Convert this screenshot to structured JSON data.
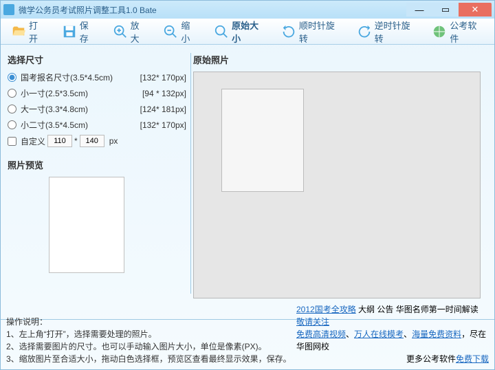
{
  "window": {
    "title": "微学公务员考试照片调整工具1.0 Bate"
  },
  "toolbar": {
    "open": "打开",
    "save": "保存",
    "zoomIn": "放大",
    "zoomOut": "缩小",
    "originalSize": "原始大小",
    "rotateCW": "顺时针旋转",
    "rotateCCW": "逆时针旋转",
    "examSoft": "公考软件"
  },
  "labels": {
    "selectSize": "选择尺寸",
    "preview": "照片预览",
    "original": "原始照片",
    "custom": "自定义",
    "px": "px"
  },
  "sizes": [
    {
      "label": "国考报名尺寸(3.5*4.5cm)",
      "dim": "[132* 170px]"
    },
    {
      "label": "小一寸(2.5*3.5cm)",
      "dim": "[94 * 132px]"
    },
    {
      "label": "大一寸(3.3*4.8cm)",
      "dim": "[124* 181px]"
    },
    {
      "label": "小二寸(3.5*4.5cm)",
      "dim": "[132* 170px]"
    }
  ],
  "customSize": {
    "w": "110",
    "h": "140"
  },
  "instructions": {
    "title": "操作说明：",
    "l1": "1、左上角“打开”，选择需要处理的照片。",
    "l2": "2、选择需要图片的尺寸。也可以手动输入图片大小，单位是像素(PX)。",
    "l3": "3、缩放图片至合适大小，拖动白色选择框，预览区查看最终显示效果，保存。"
  },
  "promo": {
    "p1a": "2012国考全攻略",
    "p1b": " 大纲 公告 华图名师第一时间解读 ",
    "p1c": "敬请关注",
    "p2a": "免费高清视频",
    "p2sep1": "、",
    "p2b": "万人在线模考",
    "p2sep2": "、",
    "p2c": "海量免费资料",
    "p2d": "，尽在华图网校",
    "p3a": "更多公考软件",
    "p3b": "免费下载"
  }
}
